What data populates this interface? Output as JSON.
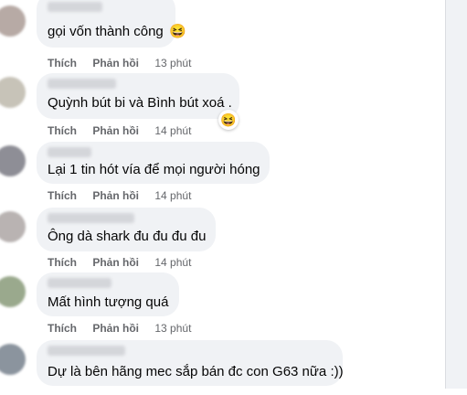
{
  "comments": [
    {
      "text": "gọi vốn thành công",
      "emoji": "😆",
      "like_label": "Thích",
      "reply_label": "Phản hồi",
      "time": "13 phút",
      "avatar_color": "#b7aaa5"
    },
    {
      "text": "Quỳnh bút bi và Bình bút xoá .",
      "emoji": "😆",
      "like_label": "Thích",
      "reply_label": "Phản hồi",
      "time": "14 phút",
      "avatar_color": "#c7c3b8"
    },
    {
      "text": "Lại 1 tin hót vía để mọi người hóng",
      "emoji": "",
      "like_label": "Thích",
      "reply_label": "Phản hồi",
      "time": "14 phút",
      "avatar_color": "#8e8e96"
    },
    {
      "text": "Ông dà shark đu đu đu đu",
      "emoji": "",
      "like_label": "Thích",
      "reply_label": "Phản hồi",
      "time": "14 phút",
      "avatar_color": "#b9b3b2"
    },
    {
      "text": "Mất hình tượng quá",
      "emoji": "",
      "like_label": "Thích",
      "reply_label": "Phản hồi",
      "time": "13 phút",
      "avatar_color": "#9aa98d"
    },
    {
      "text": "Dự là bên hãng mec sắp bán đc con G63 nữa :))",
      "emoji": "",
      "avatar_color": "#8b949e"
    }
  ]
}
